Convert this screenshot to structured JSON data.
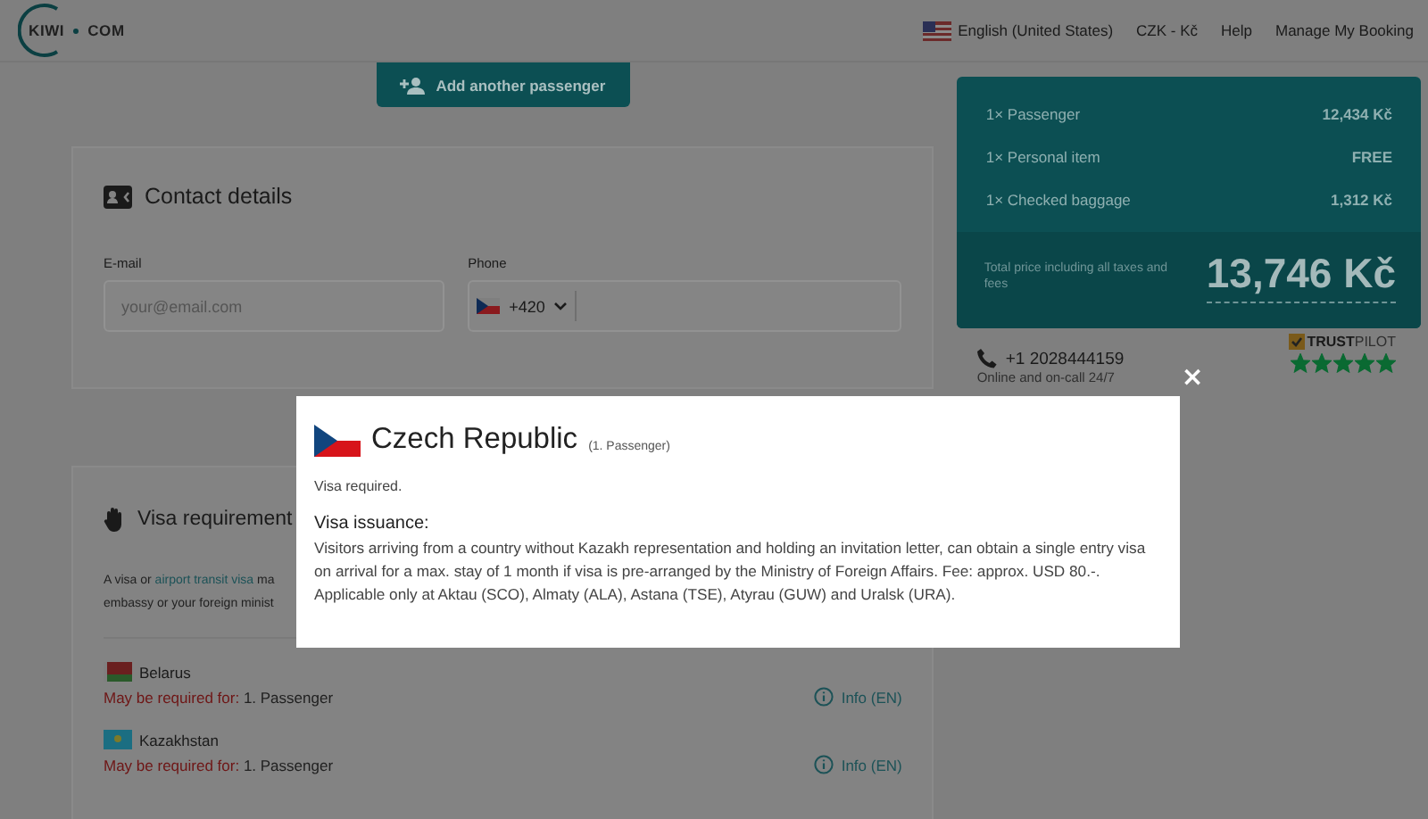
{
  "header": {
    "logo": "KIWI",
    "logo_suffix": "COM",
    "language": "English (United States)",
    "currency": "CZK - Kč",
    "links": [
      "Help",
      "Manage My Booking"
    ]
  },
  "add_passenger_button": "Add another passenger",
  "contact": {
    "title": "Contact details",
    "email": {
      "label": "E-mail",
      "placeholder": "your@email.com"
    },
    "phone": {
      "label": "Phone",
      "code": "+420"
    }
  },
  "visa": {
    "title": "Visa requirement",
    "intro": [
      {
        "before": "A visa or ",
        "link": "airport transit visa",
        "after": " ma"
      },
      {
        "before": "embassy or your foreign minist"
      }
    ],
    "rows": [
      {
        "kind": "belarus",
        "country": "Belarus",
        "label": "May be required for:",
        "who": "1. Passenger",
        "info": "Info (EN)"
      },
      {
        "kind": "kazakhstan",
        "country": "Kazakhstan",
        "label": "May be required for:",
        "who": "1. Passenger",
        "info": "Info (EN)"
      }
    ]
  },
  "price": {
    "items": [
      {
        "label": "1× Passenger",
        "value": "12,434 Kč"
      },
      {
        "label": "1× Personal item",
        "value": "FREE"
      },
      {
        "label": "1× Checked baggage",
        "value": "1,312 Kč"
      }
    ],
    "total_label": "Total price including all taxes and fees",
    "total": "13,746 Kč"
  },
  "support": {
    "phone": "+1 2028444159",
    "note": "Online and on-call 24/7"
  },
  "trustpilot": {
    "logo": "**TRUST**PILOT",
    "stars": 5
  },
  "modal": {
    "close": "×",
    "country": "Czech Republic",
    "passenger": "(1. Passenger)",
    "status": "Visa required.",
    "section_title": "Visa issuance:",
    "text": "Visitors arriving from a country without Kazakh representation and holding an invitation letter, can obtain a single entry visa on arrival for a max. stay of 1 month if visa is pre-arranged by the Ministry of Foreign Affairs. Fee: approx. USD 80.-. Applicable only at Aktau (SCO), Almaty (ALA), Astana (TSE), Atyrau (GUW) and Uralsk (URA)."
  }
}
